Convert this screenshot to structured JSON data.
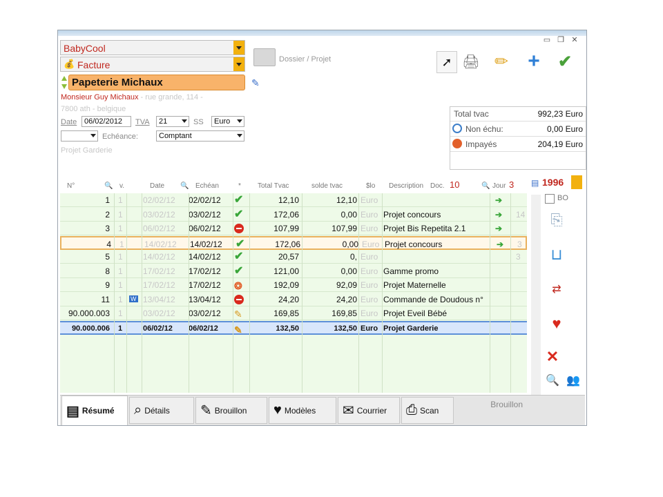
{
  "header": {
    "company": "BabyCool",
    "doc_type": "Facture",
    "client_name": "Papeterie Michaux",
    "folder_label": "Dossier / Projet",
    "contact_name": "Monsieur Guy Michaux",
    "address_line1": " - rue grande, 114 -",
    "address_line2": "7800 ath - belgique",
    "date_label": "Date",
    "date_value": "06/02/2012",
    "tva_label": "TVA",
    "tva_value": "21",
    "ss_label": "SS",
    "currency_value": "Euro",
    "echeance_label": "Echéance:",
    "payment_value": "Comptant",
    "project_label": "Projet Garderie"
  },
  "toolbar": {
    "icons": [
      "cursor-icon",
      "printer-icon",
      "pencil-icon",
      "plus-icon",
      "check-icon"
    ]
  },
  "totals": {
    "total_tvac_label": "Total tvac",
    "total_tvac_value": "992,23 Euro",
    "non_echu_label": "Non échu:",
    "non_echu_value": "0,00 Euro",
    "impayes_label": "Impayés",
    "impayes_value": "204,19 Euro"
  },
  "grid": {
    "headers": {
      "n": "N°",
      "v": "v.",
      "date": "Date",
      "echeance": "Echéan",
      "star": "*",
      "total": "Total Tvac",
      "solde": "solde tvac",
      "cur": "$lo",
      "desc": "Description",
      "doc": "Doc.",
      "doc_count": "10",
      "jour": "Jour",
      "jour_count": "3"
    },
    "counter": "1996",
    "rows": [
      {
        "n": "1",
        "v": "1",
        "date": "02/02/12",
        "ech": "02/02/12",
        "status": "check",
        "total": "12,10",
        "solde": "12,10",
        "cur": "Euro",
        "desc": "",
        "side": "",
        "extra": ""
      },
      {
        "n": "2",
        "v": "1",
        "date": "03/02/12",
        "ech": "03/02/12",
        "status": "check",
        "total": "172,06",
        "solde": "0,00",
        "cur": "Euro",
        "desc": "Projet concours",
        "side": "",
        "extra": "14"
      },
      {
        "n": "3",
        "v": "1",
        "date": "06/02/12",
        "ech": "06/02/12",
        "status": "stop",
        "total": "107,99",
        "solde": "107,99",
        "cur": "Euro",
        "desc": "Projet Bis Repetita 2.1",
        "side": "",
        "extra": ""
      },
      {
        "n": "4",
        "v": "1",
        "date": "14/02/12",
        "ech": "14/02/12",
        "status": "check",
        "total": "172,06",
        "solde": "0,00",
        "cur": "Euro",
        "desc": "Projet concours",
        "side": "",
        "extra": "3"
      },
      {
        "n": "5",
        "v": "1",
        "date": "14/02/12",
        "ech": "14/02/12",
        "status": "check",
        "total": "20,57",
        "solde": "0,",
        "cur": "Euro",
        "desc": "",
        "side": "",
        "extra": "3"
      },
      {
        "n": "8",
        "v": "1",
        "date": "17/02/12",
        "ech": "17/02/12",
        "status": "check",
        "total": "121,00",
        "solde": "0,00",
        "cur": "Euro",
        "desc": "Gamme promo",
        "side": "",
        "extra": ""
      },
      {
        "n": "9",
        "v": "1",
        "date": "17/02/12",
        "ech": "17/02/12",
        "status": "flame",
        "total": "192,09",
        "solde": "92,09",
        "cur": "Euro",
        "desc": "Projet Maternelle",
        "side": "",
        "extra": ""
      },
      {
        "n": "11",
        "v": "1",
        "date": "13/04/12",
        "ech": "13/04/12",
        "status": "stop",
        "total": "24,20",
        "solde": "24,20",
        "cur": "Euro",
        "desc": "Commande de Doudous n°",
        "side": "W",
        "extra": ""
      },
      {
        "n": "90.000.003",
        "v": "1",
        "date": "03/02/12",
        "ech": "03/02/12",
        "status": "pen",
        "total": "169,85",
        "solde": "169,85",
        "cur": "Euro",
        "desc": "Projet Eveil Bébé",
        "side": "",
        "extra": ""
      },
      {
        "n": "90.000.006",
        "v": "1",
        "date": "06/02/12",
        "ech": "06/02/12",
        "status": "pen",
        "total": "132,50",
        "solde": "132,50",
        "cur": "Euro",
        "desc": "Projet Garderie",
        "side": "",
        "extra": ""
      }
    ]
  },
  "side_panel": {
    "bo_label": "BO"
  },
  "tabs": [
    {
      "label": "Résumé",
      "icon": "summary-icon"
    },
    {
      "label": "Détails",
      "icon": "details-icon"
    },
    {
      "label": "Brouillon",
      "icon": "draft-icon"
    },
    {
      "label": "Modèles",
      "icon": "templates-icon"
    },
    {
      "label": "Courrier",
      "icon": "mail-icon"
    },
    {
      "label": "Scan",
      "icon": "scan-icon"
    }
  ],
  "status_word": "Brouillon",
  "colors": {
    "accent": "#f2b10f",
    "client_bg": "#f8b36a",
    "grid_bg": "#eefae8",
    "danger": "#d92a1e",
    "ok": "#3aa63a"
  }
}
